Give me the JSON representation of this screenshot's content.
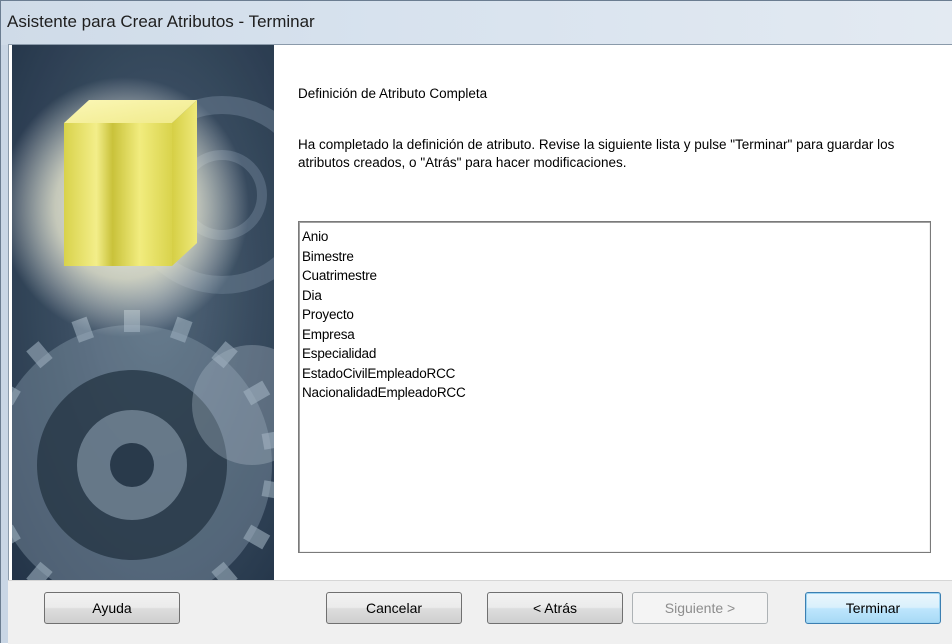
{
  "window": {
    "title": "Asistente para Crear Atributos - Terminar"
  },
  "content": {
    "heading": "Definición de Atributo Completa",
    "description": "Ha completado la definición de atributo. Revise la siguiente lista y pulse \"Terminar\" para guardar los atributos creados, o \"Atrás\" para hacer modificaciones."
  },
  "attributes": [
    "Anio",
    "Bimestre",
    "Cuatrimestre",
    "Dia",
    "Proyecto",
    "Empresa",
    "Especialidad",
    "EstadoCivilEmpleadoRCC",
    "NacionalidadEmpleadoRCC"
  ],
  "buttons": {
    "help": "Ayuda",
    "cancel": "Cancelar",
    "back": "< Atrás",
    "next": "Siguiente >",
    "finish": "Terminar"
  },
  "colors": {
    "cube_face": "#e8e36a",
    "default_button_border": "#3c7fb1"
  }
}
